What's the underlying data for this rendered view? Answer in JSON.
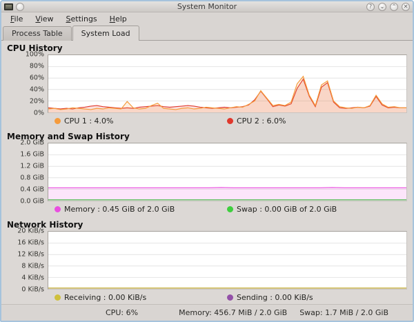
{
  "window": {
    "title": "System Monitor",
    "controls": [
      {
        "name": "help",
        "glyph": "?"
      },
      {
        "name": "shade",
        "glyph": "⌄"
      },
      {
        "name": "maximize",
        "glyph": "⌃"
      },
      {
        "name": "close",
        "glyph": "✕"
      }
    ]
  },
  "menu_bar": {
    "items": [
      "File",
      "View",
      "Settings",
      "Help"
    ]
  },
  "tab_bar": {
    "tabs": [
      "Process Table",
      "System Load"
    ],
    "active": "System Load"
  },
  "chart_data": [
    {
      "id": "cpu",
      "type": "area",
      "title": "CPU History",
      "ymax": 100,
      "ylim": [
        0,
        100
      ],
      "yticks": [
        "100%",
        "80%",
        "60%",
        "40%",
        "20%",
        "0%"
      ],
      "grid": true,
      "legend_position": "bottom",
      "series": [
        {
          "name": "CPU 1",
          "value_label": "CPU 1 : 4.0%",
          "color": "#f59b3c",
          "values": [
            6,
            7,
            5,
            6,
            8,
            7,
            6,
            5,
            7,
            6,
            8,
            7,
            6,
            19,
            8,
            6,
            7,
            12,
            16,
            7,
            6,
            5,
            7,
            8,
            6,
            7,
            9,
            8,
            7,
            6,
            8,
            10,
            9,
            14,
            20,
            38,
            25,
            12,
            14,
            12,
            18,
            50,
            63,
            30,
            12,
            48,
            55,
            20,
            10,
            8,
            7,
            9,
            8,
            12,
            30,
            15,
            9,
            10,
            8,
            8
          ]
        },
        {
          "name": "CPU 2",
          "value_label": "CPU 2 : 6.0%",
          "color": "#e0382c",
          "values": [
            8,
            7,
            6,
            7,
            6,
            8,
            9,
            11,
            12,
            10,
            9,
            8,
            7,
            8,
            7,
            9,
            10,
            11,
            12,
            10,
            9,
            10,
            11,
            12,
            11,
            9,
            8,
            7,
            8,
            9,
            8,
            9,
            10,
            13,
            22,
            37,
            24,
            10,
            13,
            11,
            15,
            42,
            58,
            28,
            10,
            44,
            52,
            18,
            8,
            7,
            8,
            9,
            8,
            11,
            28,
            13,
            8,
            9,
            8,
            8
          ]
        }
      ]
    },
    {
      "id": "memory",
      "type": "area",
      "title": "Memory and Swap History",
      "ymax": 2.0,
      "ylim": [
        0,
        2.0
      ],
      "yticks": [
        "2.0 GiB",
        "1.6 GiB",
        "1.2 GiB",
        "0.8 GiB",
        "0.4 GiB",
        "0.0 GiB"
      ],
      "grid": true,
      "legend_position": "bottom",
      "series": [
        {
          "name": "Memory",
          "value_label": "Memory : 0.45 GiB of 2.0 GiB",
          "color": "#e94fe0",
          "values": [
            0.45,
            0.45,
            0.45,
            0.45,
            0.45,
            0.45,
            0.45,
            0.45,
            0.45,
            0.45,
            0.45,
            0.45,
            0.45,
            0.45,
            0.46,
            0.45,
            0.45,
            0.45,
            0.45,
            0.45,
            0.45,
            0.45,
            0.45,
            0.46,
            0.45,
            0.45,
            0.45,
            0.45,
            0.45,
            0.45
          ]
        },
        {
          "name": "Swap",
          "value_label": "Swap : 0.00 GiB of 2.0 GiB",
          "color": "#3ecf3e",
          "values": [
            0,
            0,
            0,
            0,
            0,
            0,
            0,
            0,
            0,
            0,
            0,
            0,
            0,
            0,
            0,
            0,
            0,
            0,
            0,
            0,
            0,
            0,
            0,
            0,
            0,
            0,
            0,
            0,
            0,
            0
          ]
        }
      ]
    },
    {
      "id": "network",
      "type": "area",
      "title": "Network History",
      "ymax": 20,
      "ylim": [
        0,
        20
      ],
      "yticks": [
        "20 KiB/s",
        "16 KiB/s",
        "12 KiB/s",
        "8 KiB/s",
        "4 KiB/s",
        "0 KiB/s"
      ],
      "grid": true,
      "legend_position": "bottom",
      "series": [
        {
          "name": "Receiving",
          "value_label": "Receiving : 0.00 KiB/s",
          "color": "#cfc03c",
          "values": [
            0,
            0,
            0,
            0,
            0,
            0,
            0,
            0,
            0,
            0,
            0,
            0,
            0,
            0,
            0,
            0,
            0,
            0,
            0,
            0,
            0,
            0,
            0,
            0,
            0,
            0,
            0,
            0,
            0,
            0
          ]
        },
        {
          "name": "Sending",
          "value_label": "Sending : 0.00 KiB/s",
          "color": "#9351a8",
          "values": [
            0,
            0,
            0,
            0,
            0,
            0,
            0,
            0,
            0,
            0,
            0,
            0,
            0,
            0,
            0,
            0,
            0,
            0,
            0,
            0,
            0,
            0,
            0,
            0,
            0,
            0,
            0,
            0,
            0,
            0
          ]
        }
      ]
    }
  ],
  "status_bar": {
    "cpu": "CPU: 6%",
    "memory": "Memory: 456.7 MiB / 2.0 GiB",
    "swap": "Swap: 1.7 MiB / 2.0 GiB"
  }
}
